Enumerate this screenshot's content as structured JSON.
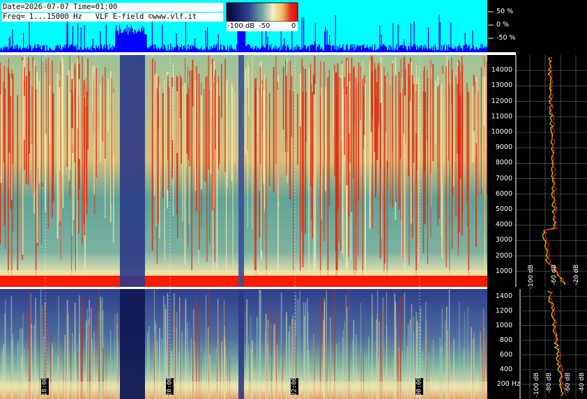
{
  "header": {
    "line1": "Date=2026-07-07 Time=01:00",
    "line2": "Freq= 1...15000 Hz   VLF E-field ©www.vlf.it"
  },
  "colorbar": {
    "labels": [
      "-100 dB",
      "-50",
      "0"
    ],
    "colors": [
      "#000033",
      "#2b3f8c",
      "#6fa8a0",
      "#f2efc8",
      "#f0c060",
      "#e03020",
      "#ff0000"
    ]
  },
  "chart_data": [
    {
      "type": "area",
      "panel": "field-amplitude",
      "ylabels": [
        "50 %",
        "0 %",
        "-50 %"
      ],
      "colors": {
        "background": "#00ffff",
        "trace": "#0000ff"
      }
    },
    {
      "type": "heatmap",
      "panel": "spectrogram-full",
      "y_ticks": [
        "14000",
        "13000",
        "12000",
        "11000",
        "10000",
        "9000",
        "8000",
        "7000",
        "6000",
        "5000",
        "4000",
        "3000",
        "2000",
        "1000"
      ],
      "ylim": [
        0,
        15000
      ],
      "time_labels": [
        "18:00",
        "20:00",
        "22:00",
        "00:00"
      ]
    },
    {
      "type": "heatmap",
      "panel": "spectrogram-low",
      "y_ticks": [
        "1400",
        "1200",
        "1000",
        "800",
        "600",
        "400",
        "200 Hz"
      ],
      "ylim": [
        0,
        1500
      ],
      "time_labels": [
        "18:00",
        "20:00",
        "22:00",
        "00:00"
      ]
    },
    {
      "type": "line",
      "panel": "spectrum-profile",
      "x_ticks": [
        "-100 dB",
        "-80 dB",
        "-60 dB",
        "-40 dB",
        "-20 dB"
      ],
      "series_colors": [
        "#ffff00",
        "#ff2020"
      ]
    }
  ]
}
